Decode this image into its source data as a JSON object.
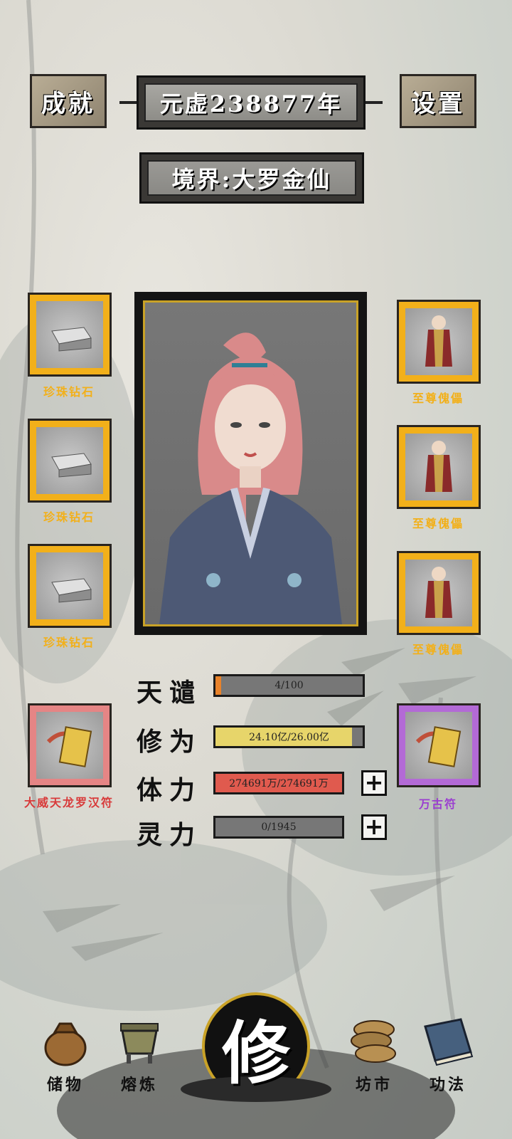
{
  "header": {
    "achievements_label": "成就",
    "year_label": "元虚238877年",
    "settings_label": "设置",
    "realm_label": "境界:大罗金仙"
  },
  "left_items": [
    {
      "name": "珍珠钻石",
      "color": "#f2b01a"
    },
    {
      "name": "珍珠钻石",
      "color": "#f2b01a"
    },
    {
      "name": "珍珠钻石",
      "color": "#f2b01a"
    }
  ],
  "right_items": [
    {
      "name": "至尊傀儡",
      "color": "#f2b01a"
    },
    {
      "name": "至尊傀儡",
      "color": "#f2b01a"
    },
    {
      "name": "至尊傀儡",
      "color": "#f2b01a"
    }
  ],
  "talismans": {
    "left": {
      "name": "大威天龙罗汉符",
      "color": "#d83a3a"
    },
    "right": {
      "name": "万古符",
      "color": "#9b3fd0"
    }
  },
  "stats": [
    {
      "label": "天谴",
      "value": "4/100",
      "fill": 0.04,
      "fill_color": "#e8822a",
      "has_plus": false
    },
    {
      "label": "修为",
      "value": "24.10亿/26.00亿",
      "fill": 0.927,
      "fill_color": "#e7d56a",
      "has_plus": false
    },
    {
      "label": "体力",
      "value": "274691万/274691万",
      "fill": 1.0,
      "fill_color": "#e05a4e",
      "has_plus": true
    },
    {
      "label": "灵力",
      "value": "0/1945",
      "fill": 0.0,
      "fill_color": "#cccccc",
      "has_plus": true
    }
  ],
  "nav": {
    "storage": "储物",
    "smelt": "熔炼",
    "cultivate": "修",
    "market": "坊市",
    "skills": "功法"
  },
  "icons": {
    "storage": "pouch-icon",
    "smelt": "cauldron-icon",
    "market": "coins-icon",
    "skills": "book-icon",
    "item_left": "diamond-block-icon",
    "item_right": "puppet-icon",
    "talisman": "talisman-scroll-icon"
  }
}
